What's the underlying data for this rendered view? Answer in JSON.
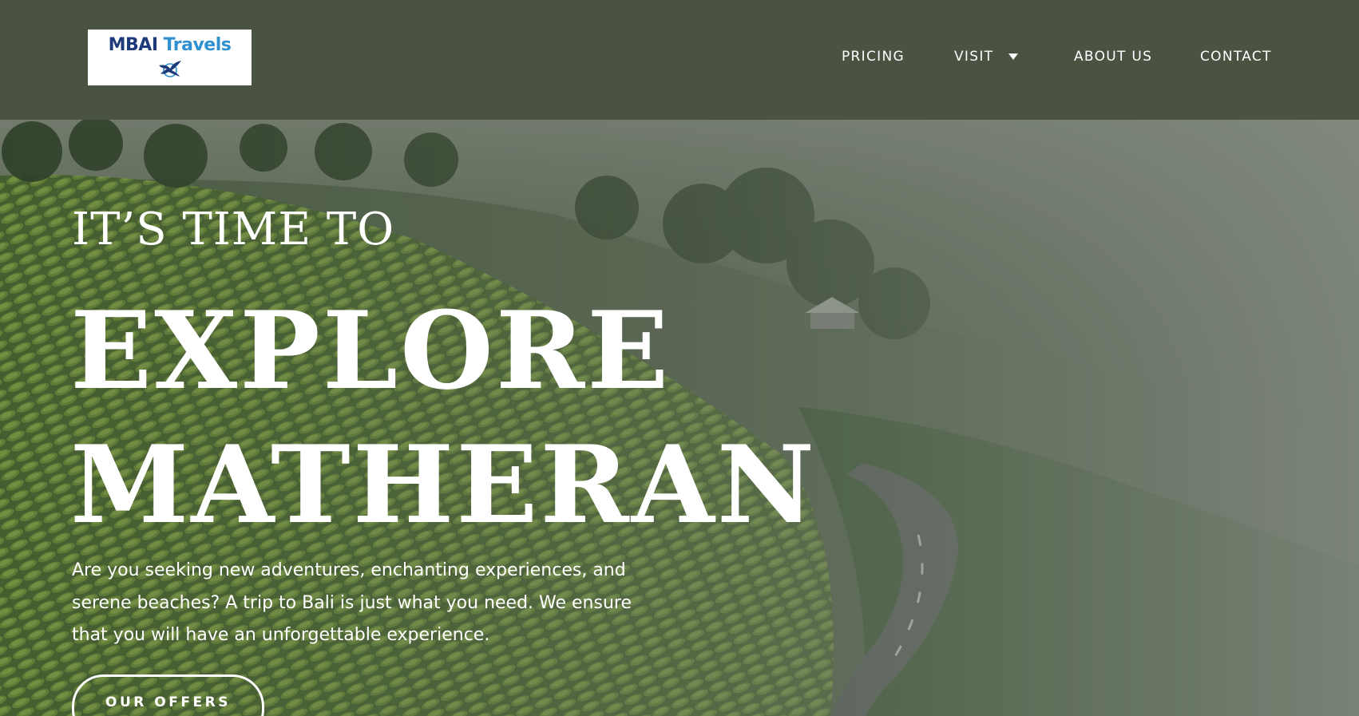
{
  "brand": {
    "name_part1": "MBAI",
    "name_part2": "Travels",
    "logo_icon": "bird-plane-icon"
  },
  "nav": {
    "pricing": "PRICING",
    "visit": "VISIT",
    "about": "ABOUT US",
    "contact": "CONTACT",
    "visit_dropdown_icon": "caret-down-icon"
  },
  "hero": {
    "eyebrow": "IT’S TIME TO",
    "title_line1": "EXPLORE",
    "title_line2": "MATHERAN",
    "description": "Are you seeking new adventures, enchanting experiences, and serene beaches? A trip to Bali is just what you need. We ensure that you will have an unforgettable experience.",
    "cta": "OUR OFFERS",
    "background": "misty green tea-plantation hills with a winding road"
  },
  "colors": {
    "header_bg": "#4a5342",
    "text": "#ffffff",
    "logo_blue_dark": "#1f3a7a",
    "logo_blue_light": "#2f8fcf"
  }
}
